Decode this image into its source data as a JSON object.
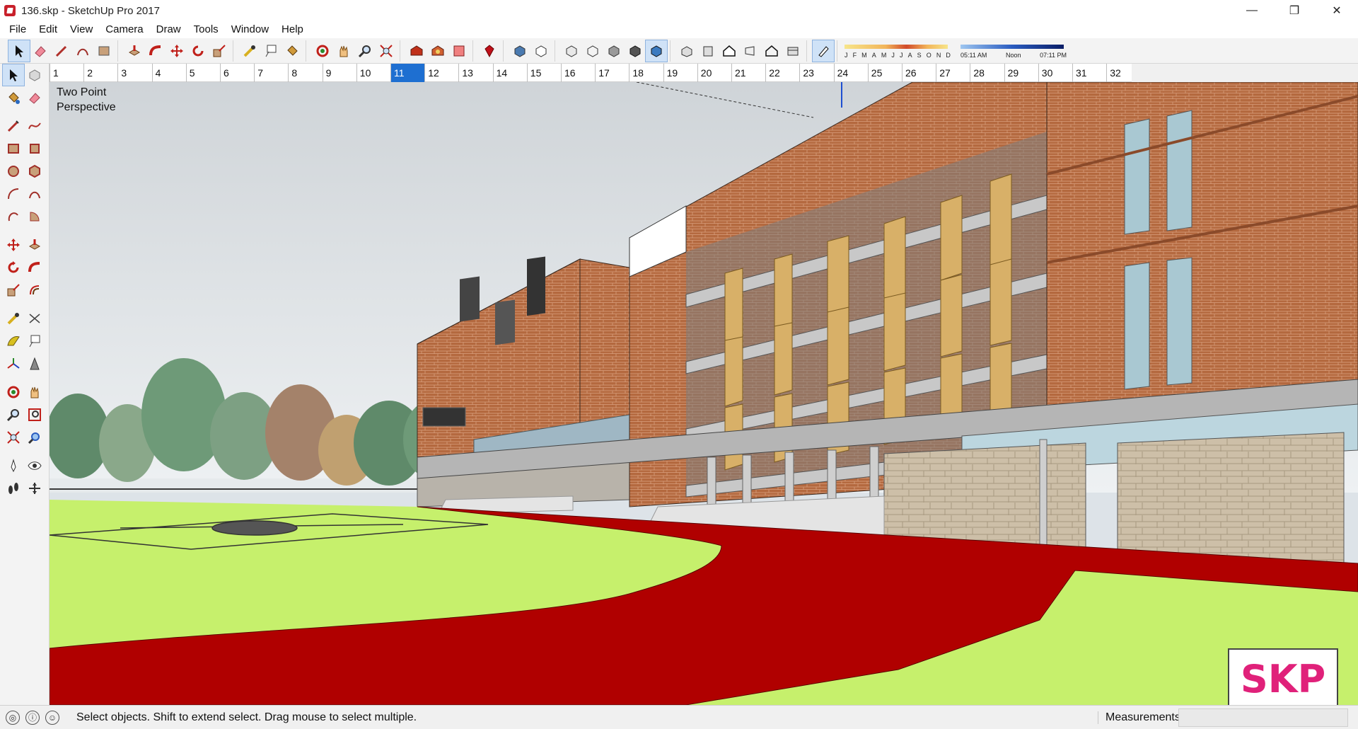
{
  "window": {
    "title": "136.skp - SketchUp Pro 2017",
    "minimize": "—",
    "maximize": "❐",
    "close": "✕"
  },
  "menu": [
    "File",
    "Edit",
    "View",
    "Camera",
    "Draw",
    "Tools",
    "Window",
    "Help"
  ],
  "toolbar": {
    "groups": [
      [
        "select-icon",
        "eraser-icon",
        "pencil-icon",
        "arc-icon",
        "rectangle-icon"
      ],
      [
        "push-pull-icon",
        "follow-me-icon",
        "move-icon",
        "rotate-icon",
        "scale-icon"
      ],
      [
        "tape-measure-icon",
        "text-icon",
        "paint-bucket-icon"
      ],
      [
        "orbit-icon",
        "pan-icon",
        "zoom-icon",
        "zoom-extents-icon"
      ],
      [
        "warehouse-icon",
        "extension-warehouse-icon",
        "layout-icon"
      ],
      [
        "ruby-icon"
      ],
      [
        "shaded-textured-icon",
        "hidden-line-icon"
      ],
      [
        "xray-icon",
        "wireframe-icon",
        "shaded-icon",
        "textured-icon",
        "monochrome-icon"
      ],
      [
        "iso-view-icon",
        "front-view-icon",
        "top-view-icon",
        "right-view-icon",
        "back-view-icon",
        "left-view-icon"
      ],
      [
        "shadows-icon"
      ]
    ],
    "months": [
      "J",
      "F",
      "M",
      "A",
      "M",
      "J",
      "J",
      "A",
      "S",
      "O",
      "N",
      "D"
    ],
    "time": {
      "start": "05:11 AM",
      "mid": "Noon",
      "end": "07:11 PM"
    }
  },
  "ruler": {
    "ticks": [
      "1",
      "2",
      "3",
      "4",
      "5",
      "6",
      "7",
      "8",
      "9",
      "10",
      "11",
      "12",
      "13",
      "14",
      "15",
      "16",
      "17",
      "18",
      "19",
      "20",
      "21",
      "22",
      "23",
      "24",
      "25",
      "26",
      "27",
      "28",
      "29",
      "30",
      "31",
      "32"
    ],
    "current": "11"
  },
  "viewport": {
    "camera_label_line1": "Two Point",
    "camera_label_line2": "Perspective",
    "logo_text": "SKP"
  },
  "status": {
    "message": "Select objects. Shift to extend select. Drag mouse to select multiple.",
    "measurements_label": "Measurements",
    "measurements_value": ""
  },
  "colors": {
    "brick": "#b4693f",
    "lawn": "#c6f06c",
    "road": "#b00000",
    "sky": "#dde3e8",
    "selection": "#1e6fd1"
  }
}
